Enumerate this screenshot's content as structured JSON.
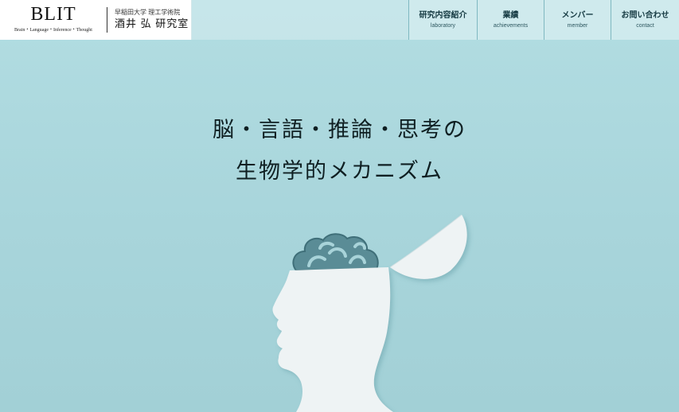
{
  "header": {
    "logo_title": "BLIT",
    "logo_subtitle": "Brain・Language・Inference・Thought",
    "university": "早稲田大学 理工学術院",
    "lab_name": "酒井 弘 研究室"
  },
  "nav": [
    {
      "label": "研究内容紹介",
      "sub": "laboratory"
    },
    {
      "label": "業績",
      "sub": "achievements"
    },
    {
      "label": "メンバー",
      "sub": "member"
    },
    {
      "label": "お問い合わせ",
      "sub": "contact"
    }
  ],
  "hero": {
    "line1": "脳・言語・推論・思考の",
    "line2": "生物学的メカニズム"
  },
  "colors": {
    "background": "#acd8dd",
    "paper": "#e9f0f2",
    "brain": "#4a7f8a"
  },
  "icons": {
    "illustration": "head-with-brain-illustration"
  }
}
